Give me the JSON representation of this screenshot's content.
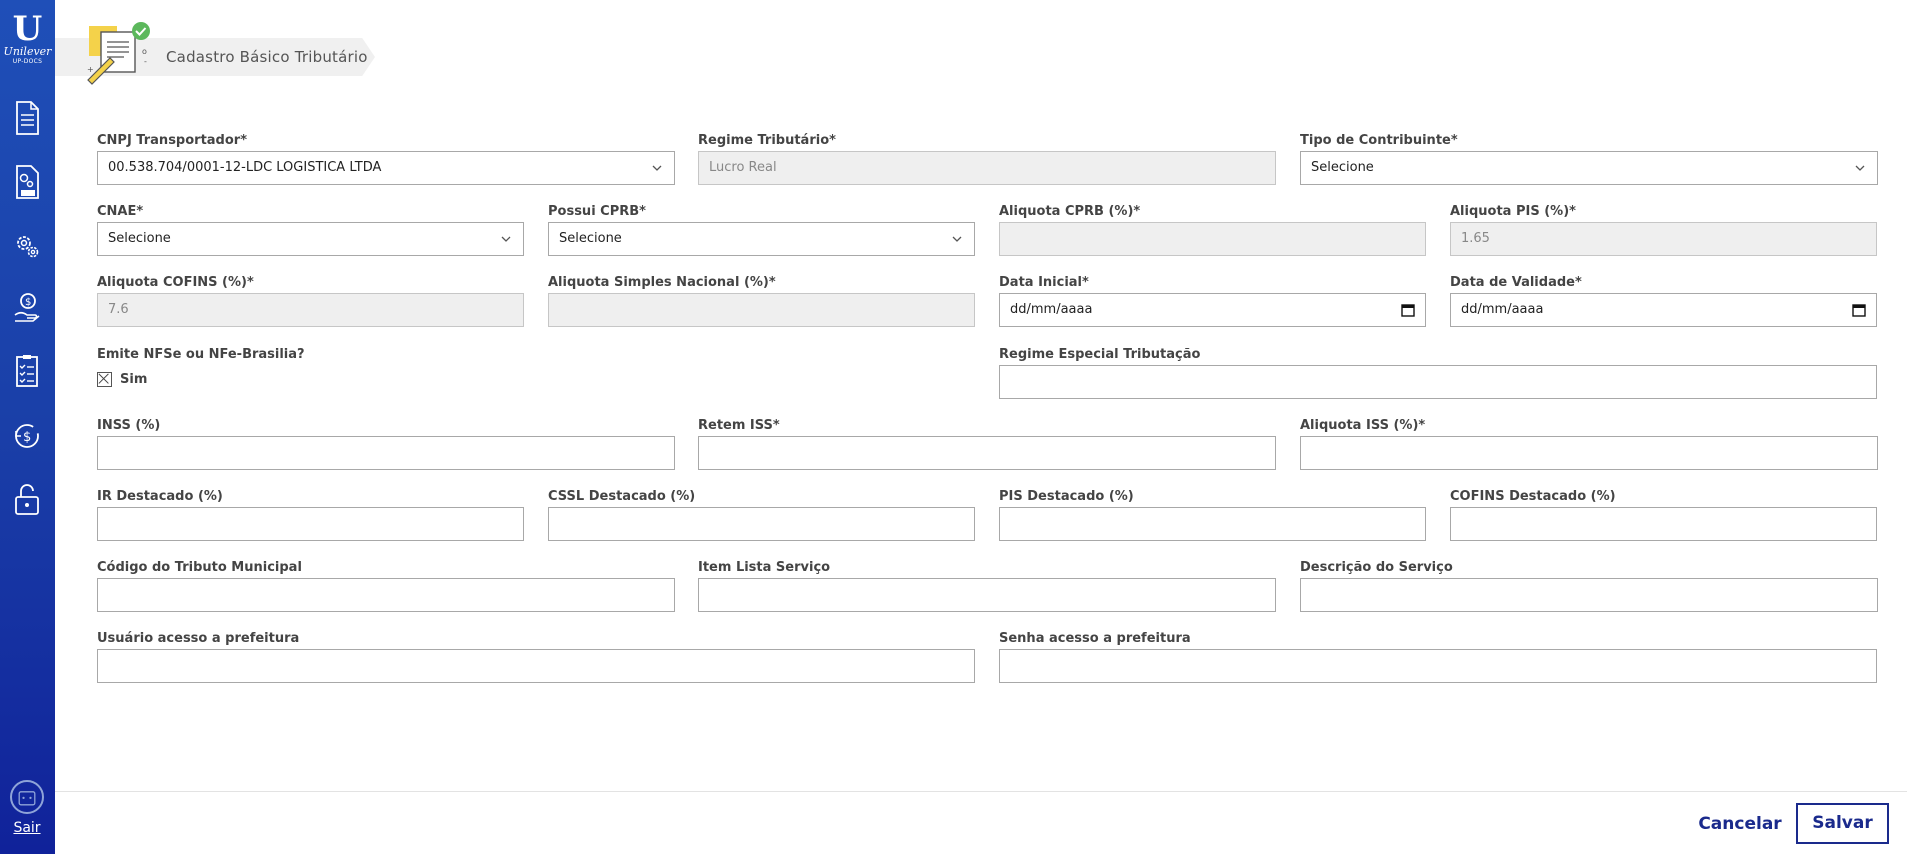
{
  "sidebar": {
    "logo_letter": "U",
    "logo_brand": "Unilever",
    "logo_sub": "UP-DOCS",
    "exit_label": "Sair"
  },
  "header": {
    "title": "Cadastro Básico Tributário"
  },
  "form": {
    "cnpj": {
      "label": "CNPJ Transportador*",
      "value": "00.538.704/0001-12-LDC LOGISTICA LTDA"
    },
    "regime": {
      "label": "Regime Tributário*",
      "value": "Lucro Real"
    },
    "tipo_contribuinte": {
      "label": "Tipo de Contribuinte*",
      "value": "Selecione"
    },
    "cnae": {
      "label": "CNAE*",
      "value": "Selecione"
    },
    "possui_cprb": {
      "label": "Possui CPRB*",
      "value": "Selecione"
    },
    "aliquota_cprb": {
      "label": "Aliquota CPRB (%)*",
      "value": ""
    },
    "aliquota_pis": {
      "label": "Aliquota PIS (%)*",
      "value": "1.65"
    },
    "aliquota_cofins": {
      "label": "Aliquota COFINS (%)*",
      "value": "7.6"
    },
    "aliquota_simples": {
      "label": "Aliquota Simples Nacional (%)*",
      "value": ""
    },
    "data_inicial": {
      "label": "Data Inicial*",
      "value": "dd/mm/aaaa"
    },
    "data_validade": {
      "label": "Data de Validade*",
      "value": "dd/mm/aaaa"
    },
    "emite_nfse": {
      "label": "Emite NFSe ou NFe-Brasilia?",
      "option": "Sim"
    },
    "regime_especial": {
      "label": "Regime Especial Tributação",
      "value": ""
    },
    "inss": {
      "label": "INSS (%)",
      "value": ""
    },
    "retem_iss": {
      "label": "Retem ISS*",
      "value": ""
    },
    "aliquota_iss": {
      "label": "Aliquota ISS (%)*",
      "value": ""
    },
    "ir_destacado": {
      "label": "IR Destacado (%)",
      "value": ""
    },
    "cssl_destacado": {
      "label": "CSSL Destacado (%)",
      "value": ""
    },
    "pis_destacado": {
      "label": "PIS Destacado (%)",
      "value": ""
    },
    "cofins_destacado": {
      "label": "COFINS Destacado (%)",
      "value": ""
    },
    "codigo_tributo": {
      "label": "Código do Tributo Municipal",
      "value": ""
    },
    "item_lista": {
      "label": "Item Lista Serviço",
      "value": ""
    },
    "descricao_servico": {
      "label": "Descrição do Serviço",
      "value": ""
    },
    "usuario_prefeitura": {
      "label": "Usuário acesso a prefeitura",
      "value": ""
    },
    "senha_prefeitura": {
      "label": "Senha acesso a prefeitura",
      "value": ""
    }
  },
  "footer": {
    "cancel_label": "Cancelar",
    "save_label": "Salvar"
  },
  "colors": {
    "sidebar": "#1a3fa8",
    "primary": "#1a2a8c",
    "disabled_bg": "#efefef"
  }
}
